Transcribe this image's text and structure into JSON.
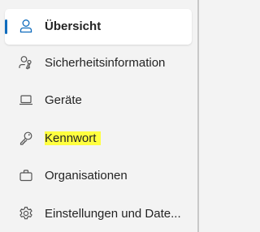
{
  "nav": {
    "accent_color": "#0f6cbd",
    "highlight_color": "#ffff40",
    "items": [
      {
        "label": "Übersicht",
        "icon": "person-icon",
        "active": true
      },
      {
        "label": "Sicherheitsinformation",
        "icon": "person-key-icon",
        "active": false
      },
      {
        "label": "Geräte",
        "icon": "laptop-icon",
        "active": false
      },
      {
        "label": "Kennwort",
        "icon": "key-icon",
        "active": false,
        "highlighted": true
      },
      {
        "label": "Organisationen",
        "icon": "briefcase-icon",
        "active": false
      },
      {
        "label": "Einstellungen und Date...",
        "icon": "gear-icon",
        "active": false
      }
    ]
  }
}
